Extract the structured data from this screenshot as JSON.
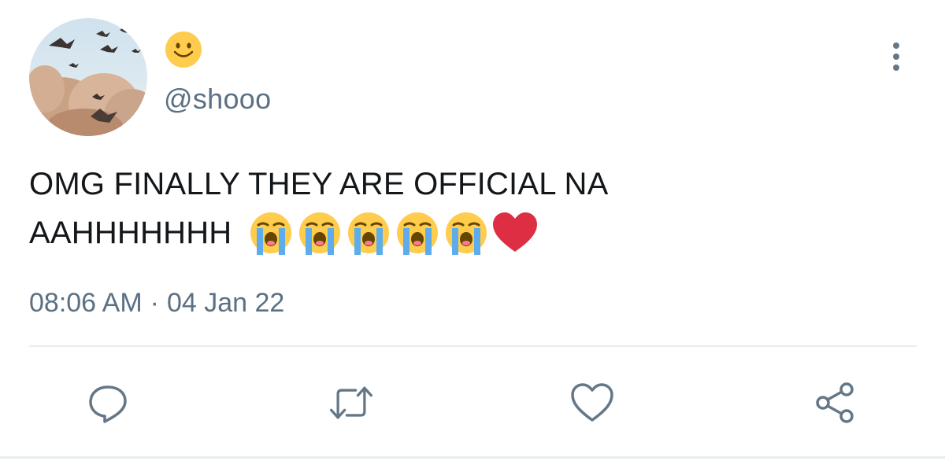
{
  "tweet": {
    "display_name_icon": "smiling-face-emoji",
    "handle": "@shooo",
    "text_line1": "OMG FINALLY THEY ARE OFFICIAL NA",
    "text_line2": "AAHHHHHHH",
    "emojis": [
      "loudly-crying-face",
      "loudly-crying-face",
      "loudly-crying-face",
      "loudly-crying-face",
      "loudly-crying-face",
      "red-heart"
    ],
    "time": "08:06 AM",
    "separator": "·",
    "date": "04 Jan 22"
  },
  "actions": [
    {
      "name": "reply",
      "icon": "comment-icon"
    },
    {
      "name": "retweet",
      "icon": "retweet-icon"
    },
    {
      "name": "like",
      "icon": "heart-icon"
    },
    {
      "name": "share",
      "icon": "share-icon"
    }
  ],
  "colors": {
    "text": "#14171a",
    "secondary": "#5b7083",
    "icon": "#657786",
    "divider": "#e6ecf0",
    "heart_emoji": "#dd2e44",
    "emoji_face": "#ffcc4d",
    "tear": "#5dadec"
  }
}
